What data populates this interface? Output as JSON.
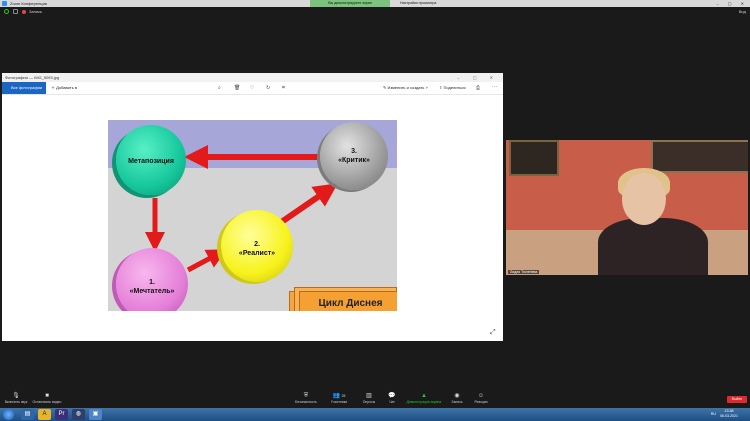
{
  "zoom": {
    "window_title": "Zoom Конференция",
    "notice_green": "Вы демонстрируете экран",
    "notice_speaker": "Настройки просмотра",
    "recording_label": "Запись",
    "speaker_view_label": "Вид"
  },
  "photos": {
    "title": "Фотографии — IMG_5093.jpg",
    "all_photos": "Все фотографии",
    "add_to": "Добавить в",
    "edit_create": "Изменить и создать",
    "share": "Поделиться"
  },
  "slide": {
    "metaposition": "Метапозиция",
    "dreamer_num": "1.",
    "dreamer": "«Мечтатель»",
    "realist_num": "2.",
    "realist": "«Реалист»",
    "critic_num": "3.",
    "critic": "«Критик»",
    "cycle": "Цикл Диснея"
  },
  "video": {
    "participant_name": "Лидия Тюленева"
  },
  "toolbar": {
    "mute": "Включить звук",
    "video": "Остановить видео",
    "security": "Безопасность",
    "participants": "Участники",
    "participants_count": "25",
    "polls": "Опросы",
    "chat": "Чат",
    "share": "Демонстрация экрана",
    "record": "Запись",
    "reactions": "Реакции",
    "leave": "Выйти"
  },
  "taskbar": {
    "lang": "RU",
    "time": "13:38",
    "date": "06.03.2021"
  },
  "colors": {
    "accent": "#1a66c2",
    "zoom_green": "#27c627",
    "leave_red": "#e0282e",
    "slide_band": "#a7a6d9"
  }
}
